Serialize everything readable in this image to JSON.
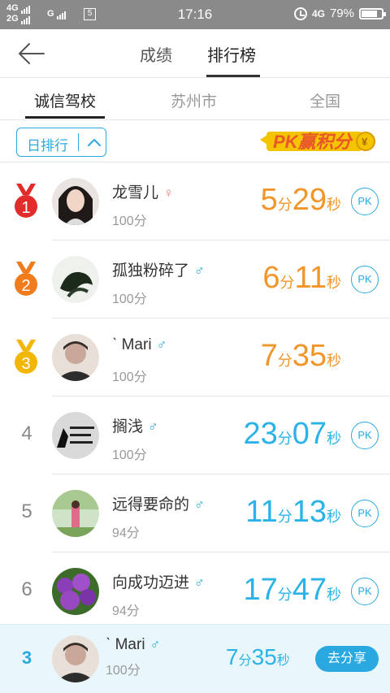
{
  "status_bar": {
    "net1": "4G",
    "net2": "2G",
    "net3": "G",
    "time": "17:16",
    "net_right": "4G",
    "battery": "79%",
    "battery_level": 0.79,
    "icons": [
      "signal-icon",
      "sim-icon",
      "alarm-icon",
      "battery-icon"
    ]
  },
  "nav": {
    "tabs": [
      {
        "label": "成绩",
        "active": false
      },
      {
        "label": "排行榜",
        "active": true
      }
    ]
  },
  "subtabs": [
    {
      "label": "诚信驾校",
      "active": true
    },
    {
      "label": "苏州市",
      "active": false
    },
    {
      "label": "全国",
      "active": false
    }
  ],
  "filter": {
    "label": "日排行"
  },
  "pk_banner": {
    "text": "PK赢积分",
    "coin": "¥"
  },
  "colors": {
    "accent": "#29a9e0",
    "time_orange": "#f0962a",
    "time_blue": "#2bb3e8",
    "gold_medal": "#f2b705",
    "silver_medal": "#f07c1e",
    "red_medal": "#e22b2b"
  },
  "ranking": [
    {
      "rank": "1",
      "medal": "red",
      "name": "龙雪儿",
      "gender": "♀",
      "gender_type": "female",
      "score": "100分",
      "min": "5",
      "sec": "29",
      "min_unit": "分",
      "sec_unit": "秒",
      "color": "orange",
      "pk": "PK"
    },
    {
      "rank": "2",
      "medal": "orange",
      "name": "孤独粉碎了",
      "gender": "♂",
      "gender_type": "male",
      "score": "100分",
      "min": "6",
      "sec": "11",
      "min_unit": "分",
      "sec_unit": "秒",
      "color": "orange",
      "pk": "PK"
    },
    {
      "rank": "3",
      "medal": "gold",
      "name": "ˋ Mari",
      "gender": "♂",
      "gender_type": "male",
      "score": "100分",
      "min": "7",
      "sec": "35",
      "min_unit": "分",
      "sec_unit": "秒",
      "color": "orange",
      "pk": ""
    },
    {
      "rank": "4",
      "medal": "",
      "name": "搁浅",
      "gender": "♂",
      "gender_type": "male",
      "score": "100分",
      "min": "23",
      "sec": "07",
      "min_unit": "分",
      "sec_unit": "秒",
      "color": "blue",
      "pk": "PK"
    },
    {
      "rank": "5",
      "medal": "",
      "name": "远得要命的",
      "gender": "♂",
      "gender_type": "male",
      "score": "94分",
      "min": "11",
      "sec": "13",
      "min_unit": "分",
      "sec_unit": "秒",
      "color": "blue",
      "pk": "PK"
    },
    {
      "rank": "6",
      "medal": "",
      "name": "向成功迈进",
      "gender": "♂",
      "gender_type": "male",
      "score": "94分",
      "min": "17",
      "sec": "47",
      "min_unit": "分",
      "sec_unit": "秒",
      "color": "blue",
      "pk": "PK"
    }
  ],
  "me": {
    "rank": "3",
    "name": "ˋ Mari",
    "gender": "♂",
    "score": "100分",
    "min": "7",
    "sec": "35",
    "min_unit": "分",
    "sec_unit": "秒",
    "share_label": "去分享"
  }
}
